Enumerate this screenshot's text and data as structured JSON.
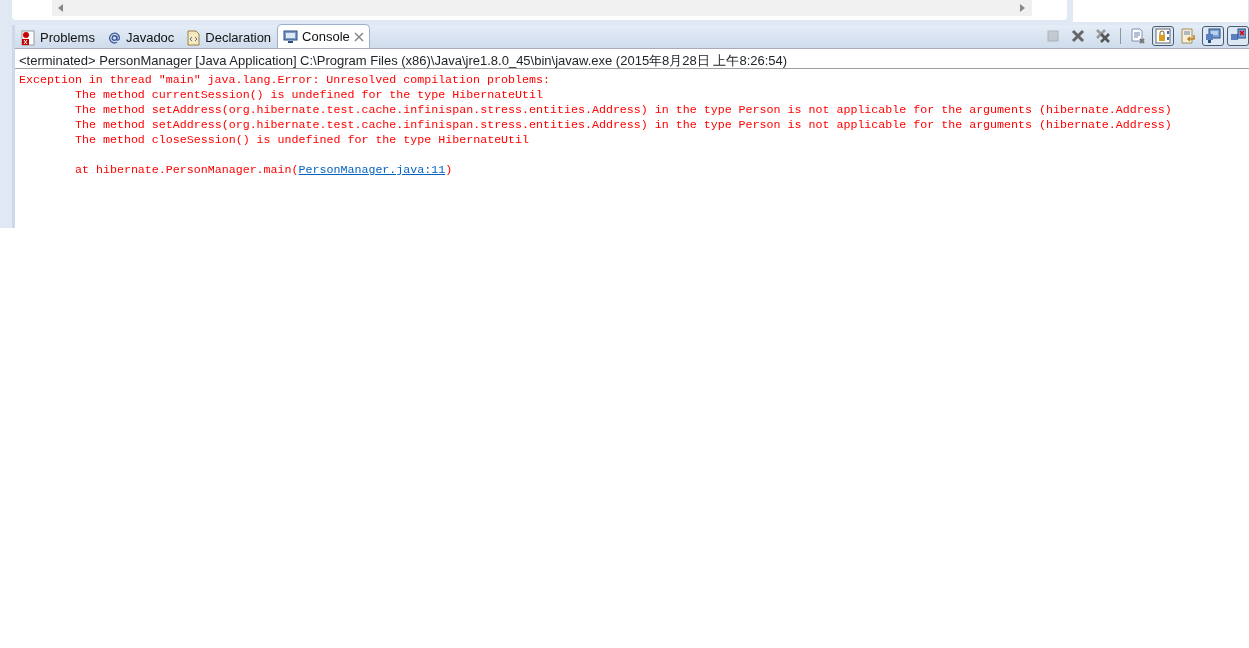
{
  "tabs": [
    {
      "label": "Problems",
      "selected": false,
      "closable": false
    },
    {
      "label": "Javadoc",
      "selected": false,
      "closable": false
    },
    {
      "label": "Declaration",
      "selected": false,
      "closable": false
    },
    {
      "label": "Console",
      "selected": true,
      "closable": true
    }
  ],
  "toolbar": [
    {
      "disabled": true,
      "pressed": false
    },
    {
      "disabled": false,
      "pressed": false
    },
    {
      "disabled": false,
      "pressed": false
    },
    {
      "disabled": false,
      "pressed": false
    },
    {
      "disabled": false,
      "pressed": true
    },
    {
      "disabled": false,
      "pressed": false
    },
    {
      "disabled": false,
      "pressed": true
    },
    {
      "disabled": false,
      "pressed": true
    }
  ],
  "console": {
    "header": "<terminated> PersonManager [Java Application] C:\\Program Files (x86)\\Java\\jre1.8.0_45\\bin\\javaw.exe (2015年8月28日 上午8:26:54)",
    "lines": [
      {
        "kind": "head",
        "text": "Exception in thread \"main\" java.lang.Error: Unresolved compilation problems: "
      },
      {
        "kind": "detail",
        "text": "The method currentSession() is undefined for the type HibernateUtil"
      },
      {
        "kind": "detail",
        "text": "The method setAddress(org.hibernate.test.cache.infinispan.stress.entities.Address) in the type Person is not applicable for the arguments (hibernate.Address)"
      },
      {
        "kind": "detail",
        "text": "The method setAddress(org.hibernate.test.cache.infinispan.stress.entities.Address) in the type Person is not applicable for the arguments (hibernate.Address)"
      },
      {
        "kind": "detail",
        "text": "The method closeSession() is undefined for the type HibernateUtil"
      },
      {
        "kind": "blank"
      },
      {
        "kind": "trace",
        "before": "at hibernate.PersonManager.main(",
        "link": "PersonManager.java:11",
        "after": ")"
      }
    ]
  }
}
